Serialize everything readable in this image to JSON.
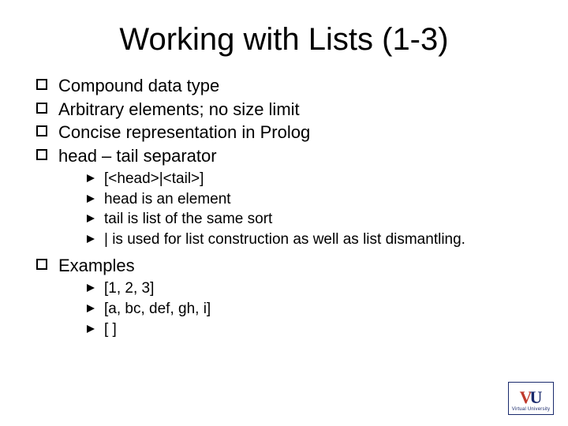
{
  "title": "Working with Lists (1-3)",
  "bullets": {
    "b0": "Compound data type",
    "b1": "Arbitrary elements; no size limit",
    "b2": "Concise representation in Prolog",
    "b3": "head – tail separator",
    "b3_sub": {
      "s0": "[<head>|<tail>]",
      "s1": "head is an element",
      "s2": "tail is list of the same sort",
      "s3": "| is used for list construction as well as list dismantling."
    },
    "b4": "Examples",
    "b4_sub": {
      "s0": "[1, 2, 3]",
      "s1": "[a, bc, def, gh, i]",
      "s2": "[ ]"
    }
  },
  "logo": {
    "v": "V",
    "u": "U",
    "sub": "Virtual University"
  }
}
